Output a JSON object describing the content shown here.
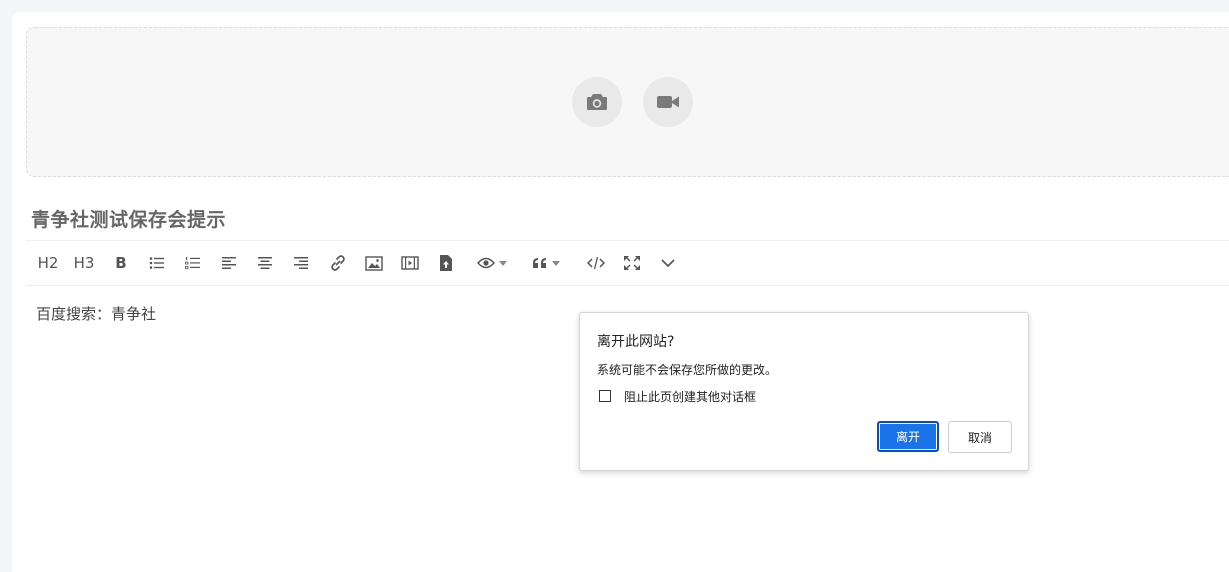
{
  "post": {
    "title": "青争社测试保存会提示",
    "body": "百度搜索：青争社"
  },
  "media": {
    "photo_icon": "camera-icon",
    "video_icon": "video-camera-icon"
  },
  "toolbar": {
    "h2": "H2",
    "h3": "H3",
    "bold": "B",
    "icons": [
      "unordered-list-icon",
      "ordered-list-icon",
      "align-left-icon",
      "align-center-icon",
      "align-right-icon",
      "link-icon",
      "image-icon",
      "video-icon",
      "upload-file-icon",
      "preview-eye-icon",
      "quote-icon",
      "code-icon",
      "fullscreen-icon",
      "more-chevron-icon"
    ]
  },
  "dialog": {
    "title": "离开此网站?",
    "message": "系统可能不会保存您所做的更改。",
    "checkbox_label": "阻止此页创建其他对话框",
    "leave_label": "离开",
    "cancel_label": "取消",
    "accent": "#1a73e8"
  }
}
